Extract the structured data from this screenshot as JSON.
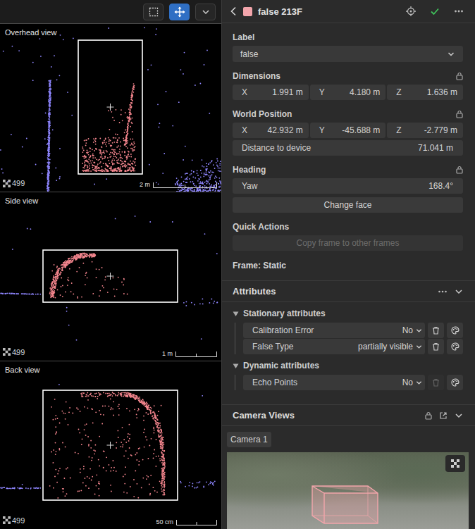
{
  "toolbar": {
    "tools": [
      {
        "kind": "select",
        "selected": false
      },
      {
        "kind": "move",
        "selected": true
      },
      {
        "kind": "menu",
        "selected": false
      }
    ]
  },
  "views": [
    {
      "kind": "overhead",
      "title": "Overhead view",
      "count": "499",
      "scale": "2 m"
    },
    {
      "kind": "side",
      "title": "Side view",
      "count": "499",
      "scale": "1 m"
    },
    {
      "kind": "back",
      "title": "Back view",
      "count": "499",
      "scale": "50 cm"
    }
  ],
  "object": {
    "title": "false 213F",
    "color": "#f2a5ab"
  },
  "label_field": {
    "title": "Label",
    "value": "false"
  },
  "dimensions": {
    "title": "Dimensions",
    "locked": true,
    "fields": [
      {
        "axis": "X",
        "value": "1.991 m"
      },
      {
        "axis": "Y",
        "value": "4.180 m"
      },
      {
        "axis": "Z",
        "value": "1.636 m"
      }
    ]
  },
  "world_position": {
    "title": "World Position",
    "locked": true,
    "fields": [
      {
        "axis": "X",
        "value": "42.932 m"
      },
      {
        "axis": "Y",
        "value": "-45.688 m"
      },
      {
        "axis": "Z",
        "value": "-2.779 m"
      }
    ],
    "distance": {
      "label": "Distance to device",
      "value": "71.041 m"
    }
  },
  "heading": {
    "title": "Heading",
    "locked": true,
    "yaw": {
      "label": "Yaw",
      "value": "168.4°"
    },
    "button": "Change face"
  },
  "quick_actions": {
    "title": "Quick Actions",
    "button": {
      "label": "Copy frame to other frames",
      "disabled": true
    }
  },
  "frame": "Frame: Static",
  "attributes": {
    "title": "Attributes",
    "expanded": true,
    "groups": [
      {
        "title": "Stationary attributes",
        "expanded": true,
        "items": [
          {
            "name": "Calibration Error",
            "value": "No",
            "deletable": true
          },
          {
            "name": "False Type",
            "value": "partially visible",
            "deletable": true
          }
        ]
      },
      {
        "title": "Dynamic attributes",
        "expanded": true,
        "items": [
          {
            "name": "Echo Points",
            "value": "No",
            "deletable": false
          }
        ]
      }
    ]
  },
  "camera_views": {
    "title": "Camera Views",
    "expanded": true,
    "tabs": [
      {
        "label": "Camera 1",
        "selected": true
      }
    ]
  }
}
